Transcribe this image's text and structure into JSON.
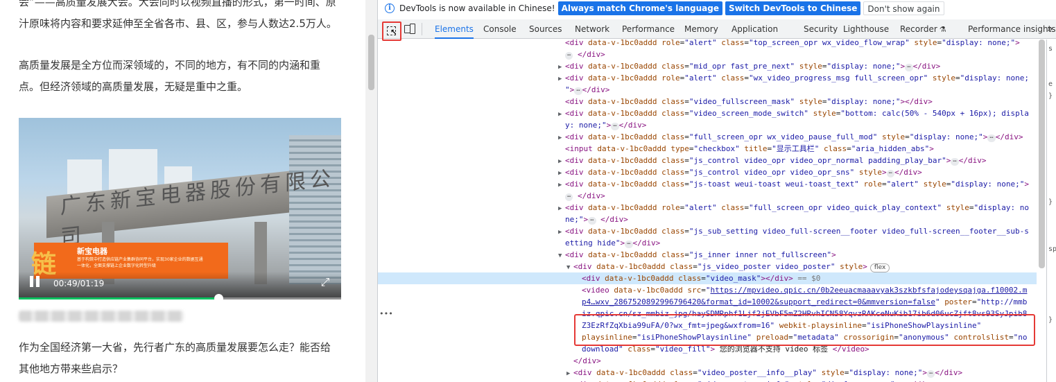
{
  "article": {
    "p_top_line1": "会”——高质量发展大会。大会同时以视频直播的形式，第一时间、原",
    "p_top_line2": "汁原味将内容和要求延伸至全省各市、县、区，参与人数达2.5万人。",
    "p2_line1": "高质量发展是全方位而深领域的，不同的地方，有不同的内涵和重",
    "p2_line2": "点。但经济领域的高质量发展，无疑是重中之重。",
    "p3_line1": "作为全国经济第一大省，先行者广东的高质量发展要怎么走？能否给",
    "p3_line2": "其他地方带来些启示？",
    "video": {
      "sign_text": "广东新宝电器股份有限公司",
      "banner_title": "新宝电器",
      "banner_sub1": "基于构筑中打造供应链产业集群协同平台，实现30家企业的数据互通",
      "banner_sub2": "一体化，全面支撑链上企业数字化转型升级",
      "logo_char": "链",
      "time": "00:49/01:19",
      "progress": 0.62
    }
  },
  "devtools": {
    "infobar": {
      "text": "DevTools is now available in Chinese!",
      "btn_match": "Always match Chrome's language",
      "btn_switch": "Switch DevTools to Chinese",
      "btn_dont": "Don't show again"
    },
    "tabs": [
      "Elements",
      "Console",
      "Sources",
      "Network",
      "Performance",
      "Memory",
      "Application",
      "Security",
      "Lighthouse",
      "Recorder",
      "Performance insights"
    ],
    "active_tab": "Elements",
    "more": "»",
    "dom_lines": [
      {
        "indent": 0,
        "tri": "",
        "html": "<span class='tg'>&lt;div</span> <span class='an'>data-v-1bc0addd</span> <span class='an'>role</span>=<span class='av'>\"alert\"</span> <span class='an'>class</span>=<span class='av'>\"top_screen_opr wx_video_flow_wrap\"</span> <span class='an'>style</span>=<span class='av'>\"display: none;\"</span><span class='tg'>&gt;</span>"
      },
      {
        "indent": 0,
        "tri": "",
        "html": "<span class='dots'>⋯</span> <span class='tg'>&lt;/div&gt;</span>"
      },
      {
        "indent": 0,
        "tri": "▶",
        "html": "<span class='tg'>&lt;div</span> <span class='an'>data-v-1bc0addd</span> <span class='an'>class</span>=<span class='av'>\"mid_opr fast_pre_next\"</span> <span class='an'>style</span>=<span class='av'>\"display: none;\"</span><span class='tg'>&gt;</span><span class='dots'>⋯</span><span class='tg'>&lt;/div&gt;</span>"
      },
      {
        "indent": 0,
        "tri": "▶",
        "html": "<span class='tg'>&lt;div</span> <span class='an'>data-v-1bc0addd</span> <span class='an'>role</span>=<span class='av'>\"alert\"</span> <span class='an'>class</span>=<span class='av'>\"wx_video_progress_msg full_screen_opr\"</span> <span class='an'>style</span>=<span class='av'>\"display: none;</span>"
      },
      {
        "indent": 0,
        "tri": "",
        "html": "<span class='av'>\"</span><span class='tg'>&gt;</span><span class='dots'>⋯</span><span class='tg'>&lt;/div&gt;</span>"
      },
      {
        "indent": 0,
        "tri": "",
        "html": "<span class='tg'>&lt;div</span> <span class='an'>data-v-1bc0addd</span> <span class='an'>class</span>=<span class='av'>\"video_fullscreen_mask\"</span> <span class='an'>style</span>=<span class='av'>\"display: none;\"</span><span class='tg'>&gt;&lt;/div&gt;</span>"
      },
      {
        "indent": 0,
        "tri": "▶",
        "html": "<span class='tg'>&lt;div</span> <span class='an'>data-v-1bc0addd</span> <span class='an'>class</span>=<span class='av'>\"video_screen_mode_switch\"</span> <span class='an'>style</span>=<span class='av'>\"bottom: calc(50% - 540px + 16px); displa</span>"
      },
      {
        "indent": 0,
        "tri": "",
        "html": "<span class='av'>y: none;\"</span><span class='tg'>&gt;</span><span class='dots'>⋯</span><span class='tg'>&lt;/div&gt;</span>"
      },
      {
        "indent": 0,
        "tri": "▶",
        "html": "<span class='tg'>&lt;div</span> <span class='an'>data-v-1bc0addd</span> <span class='an'>class</span>=<span class='av'>\"full_screen_opr wx_video_pause_full_mod\"</span> <span class='an'>style</span>=<span class='av'>\"display: none;\"</span><span class='tg'>&gt;</span><span class='dots'>⋯</span><span class='tg'>&lt;/div&gt;</span>"
      },
      {
        "indent": 0,
        "tri": "",
        "html": "<span class='tg'>&lt;input</span> <span class='an'>data-v-1bc0addd</span> <span class='an'>type</span>=<span class='av'>\"checkbox\"</span> <span class='an'>title</span>=<span class='av'>\"显示工具栏\"</span> <span class='an'>class</span>=<span class='av'>\"aria_hidden_abs\"</span><span class='tg'>&gt;</span>"
      },
      {
        "indent": 0,
        "tri": "▶",
        "html": "<span class='tg'>&lt;div</span> <span class='an'>data-v-1bc0addd</span> <span class='an'>class</span>=<span class='av'>\"js_control video_opr video_opr_normal padding_play_bar\"</span><span class='tg'>&gt;</span><span class='dots'>⋯</span><span class='tg'>&lt;/div&gt;</span>"
      },
      {
        "indent": 0,
        "tri": "▶",
        "html": "<span class='tg'>&lt;div</span> <span class='an'>data-v-1bc0addd</span> <span class='an'>class</span>=<span class='av'>\"js_control video_opr video_opr_sns\"</span> <span class='an'>style</span><span class='tg'>&gt;</span><span class='dots'>⋯</span><span class='tg'>&lt;/div&gt;</span>"
      },
      {
        "indent": 0,
        "tri": "▶",
        "html": "<span class='tg'>&lt;div</span> <span class='an'>data-v-1bc0addd</span> <span class='an'>class</span>=<span class='av'>\"js-toast weui-toast weui-toast_text\"</span> <span class='an'>role</span>=<span class='av'>\"alert\"</span> <span class='an'>style</span>=<span class='av'>\"display: none;\"</span><span class='tg'>&gt;</span>"
      },
      {
        "indent": 0,
        "tri": "",
        "html": "<span class='dots'>⋯</span> <span class='tg'>&lt;/div&gt;</span>"
      },
      {
        "indent": 0,
        "tri": "▶",
        "html": "<span class='tg'>&lt;div</span> <span class='an'>data-v-1bc0addd</span> <span class='an'>role</span>=<span class='av'>\"alert\"</span> <span class='an'>class</span>=<span class='av'>\"full_screen_opr video_quick_play_context\"</span> <span class='an'>style</span>=<span class='av'>\"display: no</span>"
      },
      {
        "indent": 0,
        "tri": "",
        "html": "<span class='av'>ne;\"</span><span class='tg'>&gt;</span><span class='dots'>⋯</span> <span class='tg'>&lt;/div&gt;</span>"
      },
      {
        "indent": 0,
        "tri": "▶",
        "html": "<span class='tg'>&lt;div</span> <span class='an'>data-v-1bc0addd</span> <span class='an'>class</span>=<span class='av'>\"js_sub_setting video_full-screen__footer video_full-screen__footer__sub-s</span>"
      },
      {
        "indent": 0,
        "tri": "",
        "html": "<span class='av'>etting hide\"</span><span class='tg'>&gt;</span><span class='dots'>⋯</span><span class='tg'>&lt;/div&gt;</span>"
      },
      {
        "indent": 0,
        "tri": "▼",
        "html": "<span class='tg'>&lt;div</span> <span class='an'>data-v-1bc0addd</span> <span class='an'>class</span>=<span class='av'>\"js_inner inner not_fullscreen\"</span><span class='tg'>&gt;</span>"
      },
      {
        "indent": 1,
        "tri": "▼",
        "html": "<span class='tg'>&lt;div</span> <span class='an'>data-v-1bc0addd</span> <span class='an'>class</span>=<span class='av'>\"js_video_poster video_poster\"</span> <span class='an'>style</span><span class='tg'>&gt;</span><span class='badge'>flex</span>"
      },
      {
        "indent": 2,
        "tri": "",
        "sel": true,
        "html": "<span class='tg'>&lt;div</span> <span class='an'>data-v-1bc0addd</span> <span class='an'>class</span>=<span class='av'>\"video_mask\"</span><span class='tg'>&gt;&lt;/div&gt;</span> <span class='eq'>== $0</span>"
      },
      {
        "indent": 2,
        "tri": "",
        "html": "<span class='tg'>&lt;video</span> <span class='an'>data-v-1bc0addd</span> <span class='an'>src</span>=<span class='av'>\"</span><span class='au'>https://mpvideo.qpic.cn/0b2eeuacmaaavyak3szkbfsfajodeysqajga.f10002.m</span>"
      },
      {
        "indent": 2,
        "tri": "",
        "html": "<span class='au'>p4…wxv_2867520892996796420&amp;format_id=10002&amp;support_redirect=0&amp;mmversion=false</span><span class='av'>\"</span> <span class='an'>poster</span>=<span class='av'>\"http://mmb</span>"
      },
      {
        "indent": 2,
        "tri": "",
        "html": "<span class='av'>iz.qpic.cn/sz_mmbiz_jpg/haySDMRphf1Ljf2jEVbF5mZ2HRvhICN58YqvzRAKceNuKib17ib6d06ucZjft8vs93SyJpib8</span>"
      },
      {
        "indent": 2,
        "tri": "",
        "html": "<span class='av'>Z3EzRfZqXbia99uFA/0?wx_fmt=jpeg&amp;wxfrom=16\"</span> <span class='an'>webkit-playsinline</span>=<span class='av'>\"isiPhoneShowPlaysinline\"</span>"
      },
      {
        "indent": 2,
        "tri": "",
        "html": "<span class='an'>playsinline</span>=<span class='av'>\"isiPhoneShowPlaysinline\"</span> <span class='an'>preload</span>=<span class='av'>\"metadata\"</span> <span class='an'>crossorigin</span>=<span class='av'>\"anonymous\"</span> <span class='an'>controlslist</span>=<span class='av'>\"no</span>"
      },
      {
        "indent": 2,
        "tri": "",
        "html": "<span class='av'>download\"</span> <span class='an'>class</span>=<span class='av'>\"video_fill\"</span><span class='tg'>&gt;</span> <span class='tx'>您的浏览器不支持 video 标签</span> <span class='tg'>&lt;/video&gt;</span>"
      },
      {
        "indent": 1,
        "tri": "",
        "html": "<span class='tg'>&lt;/div&gt;</span>"
      },
      {
        "indent": 1,
        "tri": "▶",
        "html": "<span class='tg'>&lt;div</span> <span class='an'>data-v-1bc0addd</span> <span class='an'>class</span>=<span class='av'>\"video_poster__info__play\"</span> <span class='an'>style</span>=<span class='av'>\"display: none;\"</span><span class='tg'>&gt;</span><span class='dots'>⋯</span><span class='tg'>&lt;/div&gt;</span>"
      },
      {
        "indent": 1,
        "tri": "▶",
        "html": "<span class='tg'>&lt;div</span> <span class='an'>data-v-1bc0addd</span> <span class='an'>class</span>=<span class='av'>\"video_poster__info\"</span> <span class='an'>style</span>=<span class='av'>\"display: none;\"</span><span class='tg'>&gt;</span><span class='dots'>⋯</span><span class='tg'>&lt;/div&gt;</span>"
      }
    ],
    "gutter": "•••",
    "side_chars": [
      "s",
      "",
      "",
      "e",
      "}",
      "",
      "",
      "",
      "",
      "",
      "",
      "",
      "",
      "}",
      "",
      "",
      "",
      "sp",
      "",
      "",
      "",
      "",
      "",
      "}"
    ]
  }
}
